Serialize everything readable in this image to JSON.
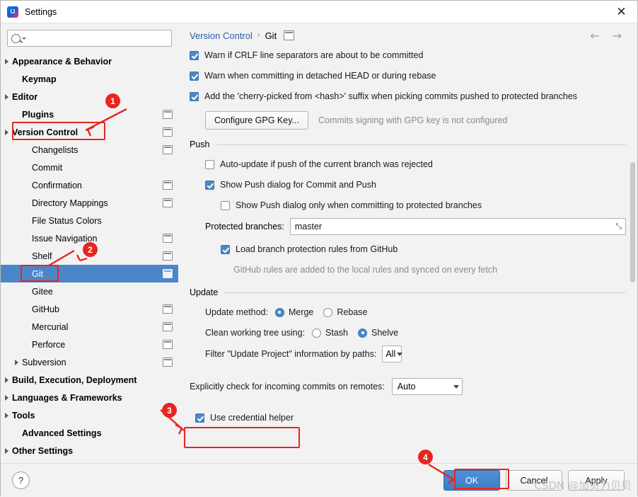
{
  "window": {
    "title": "Settings",
    "close_label": "✕",
    "logo_name": "intellij-logo"
  },
  "search": {
    "placeholder": "",
    "value": ""
  },
  "sidebar": {
    "items": [
      {
        "label": "Appearance & Behavior",
        "indent": 0,
        "arrow": true,
        "bold": true,
        "badge": false,
        "selected": false
      },
      {
        "label": "Keymap",
        "indent": 1,
        "arrow": false,
        "bold": true,
        "badge": false,
        "selected": false
      },
      {
        "label": "Editor",
        "indent": 0,
        "arrow": true,
        "bold": true,
        "badge": false,
        "selected": false
      },
      {
        "label": "Plugins",
        "indent": 1,
        "arrow": false,
        "bold": true,
        "badge": true,
        "selected": false
      },
      {
        "label": "Version Control",
        "indent": 0,
        "arrow": true,
        "bold": true,
        "badge": true,
        "selected": false
      },
      {
        "label": "Changelists",
        "indent": 2,
        "arrow": false,
        "bold": false,
        "badge": true,
        "selected": false
      },
      {
        "label": "Commit",
        "indent": 2,
        "arrow": false,
        "bold": false,
        "badge": false,
        "selected": false
      },
      {
        "label": "Confirmation",
        "indent": 2,
        "arrow": false,
        "bold": false,
        "badge": true,
        "selected": false
      },
      {
        "label": "Directory Mappings",
        "indent": 2,
        "arrow": false,
        "bold": false,
        "badge": true,
        "selected": false
      },
      {
        "label": "File Status Colors",
        "indent": 2,
        "arrow": false,
        "bold": false,
        "badge": false,
        "selected": false
      },
      {
        "label": "Issue Navigation",
        "indent": 2,
        "arrow": false,
        "bold": false,
        "badge": true,
        "selected": false
      },
      {
        "label": "Shelf",
        "indent": 2,
        "arrow": false,
        "bold": false,
        "badge": true,
        "selected": false
      },
      {
        "label": "Git",
        "indent": 2,
        "arrow": false,
        "bold": false,
        "badge": true,
        "selected": true
      },
      {
        "label": "Gitee",
        "indent": 2,
        "arrow": false,
        "bold": false,
        "badge": false,
        "selected": false
      },
      {
        "label": "GitHub",
        "indent": 2,
        "arrow": false,
        "bold": false,
        "badge": true,
        "selected": false
      },
      {
        "label": "Mercurial",
        "indent": 2,
        "arrow": false,
        "bold": false,
        "badge": true,
        "selected": false
      },
      {
        "label": "Perforce",
        "indent": 2,
        "arrow": false,
        "bold": false,
        "badge": true,
        "selected": false
      },
      {
        "label": "Subversion",
        "indent": 1,
        "arrow": true,
        "bold": false,
        "badge": true,
        "selected": false
      },
      {
        "label": "Build, Execution, Deployment",
        "indent": 0,
        "arrow": true,
        "bold": true,
        "badge": false,
        "selected": false
      },
      {
        "label": "Languages & Frameworks",
        "indent": 0,
        "arrow": true,
        "bold": true,
        "badge": false,
        "selected": false
      },
      {
        "label": "Tools",
        "indent": 0,
        "arrow": true,
        "bold": true,
        "badge": false,
        "selected": false
      },
      {
        "label": "Advanced Settings",
        "indent": 1,
        "arrow": false,
        "bold": true,
        "badge": false,
        "selected": false
      },
      {
        "label": "Other Settings",
        "indent": 0,
        "arrow": true,
        "bold": true,
        "badge": false,
        "selected": false
      }
    ]
  },
  "breadcrumb": {
    "parent": "Version Control",
    "separator": "›",
    "current": "Git",
    "back_icon": "←",
    "forward_icon": "→"
  },
  "main": {
    "top_checkboxes": [
      {
        "label": "Warn if CRLF line separators are about to be committed",
        "checked": true
      },
      {
        "label": "Warn when committing in detached HEAD or during rebase",
        "checked": true
      },
      {
        "label": "Add the 'cherry-picked from <hash>' suffix when picking commits pushed to protected branches",
        "checked": true
      }
    ],
    "gpg": {
      "button_label": "Configure GPG Key...",
      "status_text": "Commits signing with GPG key is not configured"
    },
    "push": {
      "section_title": "Push",
      "auto_update": {
        "label": "Auto-update if push of the current branch was rejected",
        "checked": false
      },
      "show_push_dialog": {
        "label": "Show Push dialog for Commit and Push",
        "checked": true
      },
      "show_push_protected": {
        "label": "Show Push dialog only when committing to protected branches",
        "checked": false
      },
      "protected_branches_label": "Protected branches:",
      "protected_branches_value": "master",
      "expand_icon": "⤡",
      "load_rules": {
        "label": "Load branch protection rules from GitHub",
        "checked": true
      },
      "hint": "GitHub rules are added to the local rules and synced on every fetch"
    },
    "update": {
      "section_title": "Update",
      "method_label": "Update method:",
      "method_options": [
        "Merge",
        "Rebase"
      ],
      "method_selected": "Merge",
      "clean_label": "Clean working tree using:",
      "clean_options": [
        "Stash",
        "Shelve"
      ],
      "clean_selected": "Shelve",
      "filter_label": "Filter \"Update Project\" information by paths:",
      "filter_value": "All"
    },
    "incoming": {
      "label": "Explicitly check for incoming commits on remotes:",
      "value": "Auto"
    },
    "credential": {
      "label": "Use credential helper",
      "checked": true
    }
  },
  "footer": {
    "help_label": "?",
    "ok_label": "OK",
    "cancel_label": "Cancel",
    "apply_label": "Apply"
  },
  "annotations": {
    "markers": [
      "1",
      "2",
      "3",
      "4"
    ],
    "accent_color": "#e8251f"
  },
  "watermark": {
    "text": "CSDN @加贝力贝贝"
  }
}
